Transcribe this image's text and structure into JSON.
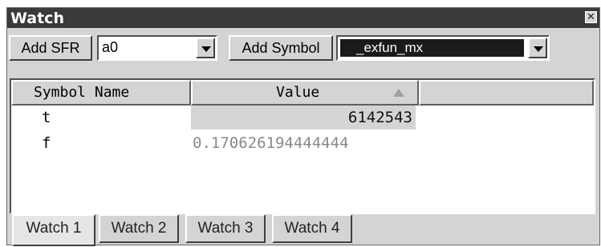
{
  "window": {
    "title": "Watch",
    "close_glyph": "✕"
  },
  "toolbar": {
    "add_sfr_label": "Add SFR",
    "sfr_value": "a0",
    "add_symbol_label": "Add Symbol",
    "symbol_value": "_exfun_mx"
  },
  "table": {
    "columns": [
      "Symbol Name",
      "Value"
    ],
    "rows": [
      {
        "name": "t",
        "value": "6142543"
      },
      {
        "name": "f",
        "value": "0.170626194444444"
      }
    ]
  },
  "tabs": [
    {
      "label": "Watch 1",
      "active": true
    },
    {
      "label": "Watch 2",
      "active": false
    },
    {
      "label": "Watch 3",
      "active": false
    },
    {
      "label": "Watch 4",
      "active": false
    }
  ],
  "icons": {
    "close": "close-icon",
    "dropdown": "chevron-down-icon",
    "sort": "sort-ascending-icon"
  }
}
